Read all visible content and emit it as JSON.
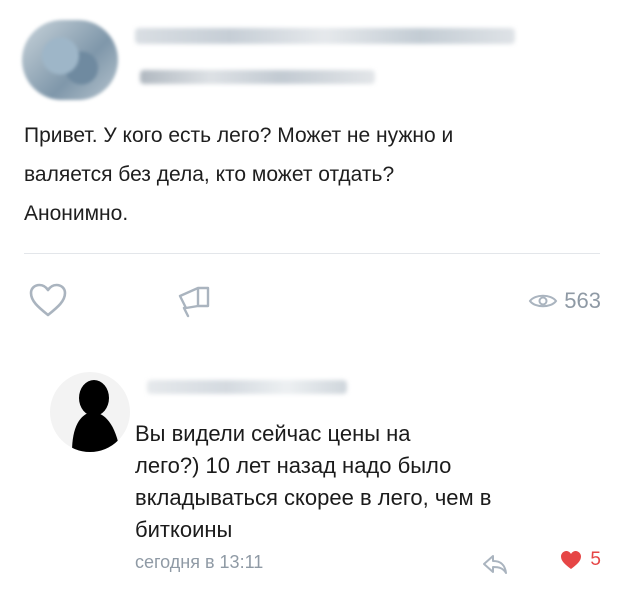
{
  "post": {
    "text": "Привет. У кого есть лего? Может не нужно и\nваляется без дела, кто может отдать?\nАнонимно.",
    "views": "563"
  },
  "comment": {
    "text": "Вы видели сейчас цены на\nлего?) 10 лет назад надо было\nвкладываться скорее в лего, чем в\nбиткоины",
    "time": "сегодня в 13:11",
    "likes": "5"
  },
  "colors": {
    "muted": "#8f9aa5",
    "like_active": "#e64646",
    "icon_outline": "#aab4bf"
  },
  "icons": [
    "heart-outline-icon",
    "share-megaphone-icon",
    "eye-icon",
    "reply-icon",
    "heart-filled-icon"
  ]
}
